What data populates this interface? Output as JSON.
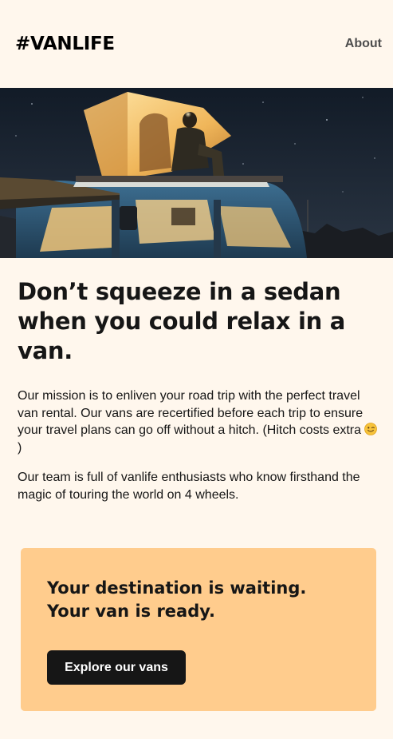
{
  "header": {
    "logo": "#VANLIFE",
    "nav": {
      "about": "About"
    }
  },
  "hero": {
    "image_icon": "van-under-night-sky-image",
    "colors": {
      "sky": "#1B2533",
      "roof_glow": "#F2C26B",
      "van_body": "#2F5A7A"
    }
  },
  "main": {
    "headline": "Don’t squeeze in a sedan when you could relax in a van.",
    "paragraph_1": "Our mission is to enliven your road trip with the perfect travel van rental. Our vans are recertified before each trip to ensure your travel plans can go off without a hitch. (Hitch costs extra",
    "paragraph_1_suffix": ")",
    "paragraph_1_emoji": "winking-face-emoji",
    "paragraph_2": "Our team is full of vanlife enthusiasts who know firsthand the magic of touring the world on 4 wheels."
  },
  "cta": {
    "title_line_1": "Your destination is waiting.",
    "title_line_2": "Your van is ready.",
    "button_label": "Explore our vans",
    "background_color": "#FFCC8D",
    "button_color": "#161616"
  },
  "colors": {
    "page_background": "#FFF7ED",
    "text": "#161616",
    "nav_text": "#4D4D4D"
  }
}
